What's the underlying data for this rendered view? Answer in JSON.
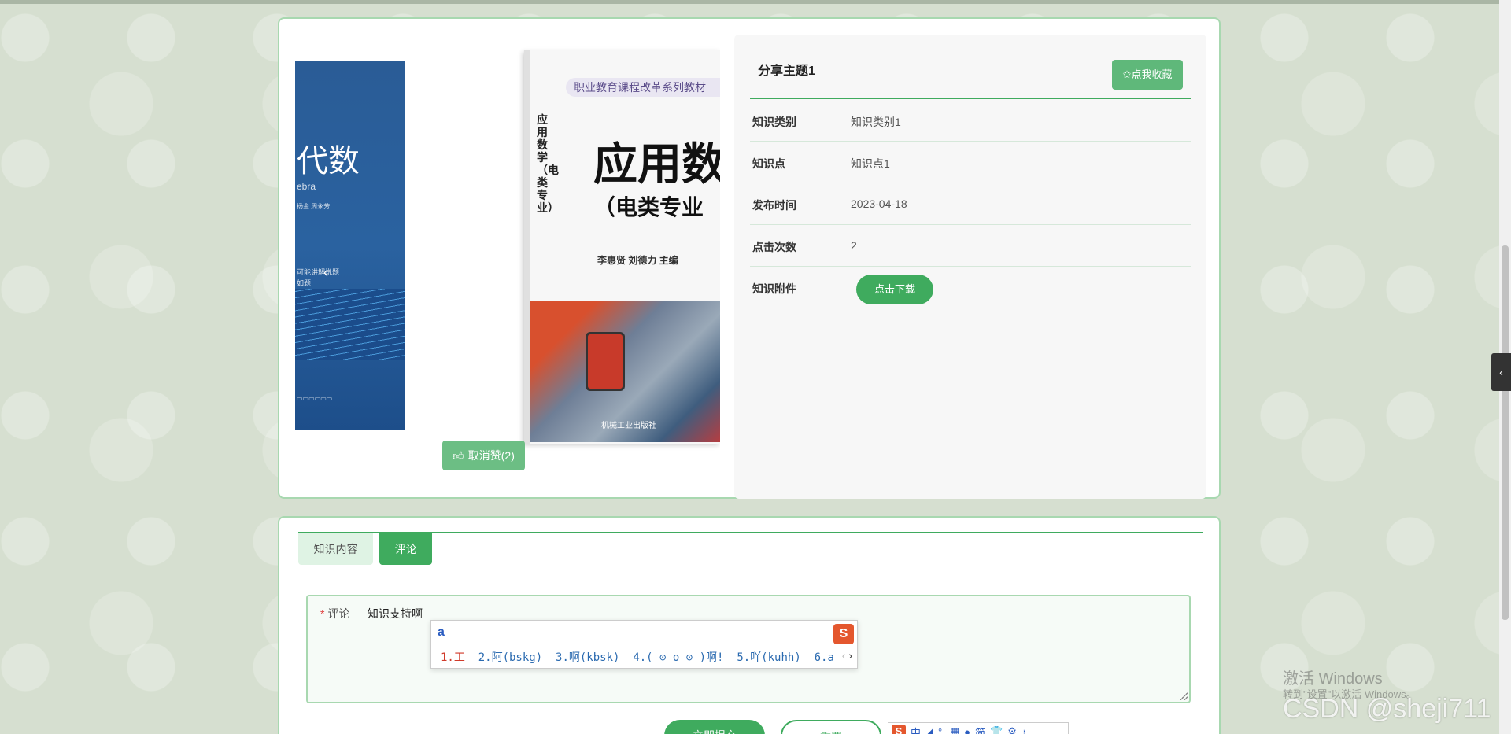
{
  "detail": {
    "carousel": {
      "left_book": {
        "title_fragment": "代数",
        "subtitle_fragment": "ebra",
        "authors_fragment": "杨金    周永芳",
        "blurb_fragment": "可能讲解说题\n如题",
        "prev_arrow": "‹"
      },
      "right_book": {
        "series": "职业教育课程改革系列教材",
        "vertical_title": "应用数学（电类专业）",
        "title": "应用数",
        "subtitle": "（电类专业",
        "authors": "李惠贤  刘德力  主编",
        "publisher": "机械工业出版社"
      }
    },
    "like_button": {
      "icon": "thumbs-up-icon",
      "label": "取消赞(2)"
    },
    "info": {
      "title": "分享主题1",
      "favorite_label": "✩点我收藏",
      "rows": [
        {
          "label": "知识类别",
          "value": "知识类别1"
        },
        {
          "label": "知识点",
          "value": "知识点1"
        },
        {
          "label": "发布时间",
          "value": "2023-04-18"
        },
        {
          "label": "点击次数",
          "value": "2"
        },
        {
          "label": "知识附件",
          "button": "点击下载"
        }
      ]
    }
  },
  "tabs": [
    {
      "label": "知识内容",
      "active": false
    },
    {
      "label": "评论",
      "active": true
    }
  ],
  "comment_form": {
    "required_mark": "*",
    "label": "评论",
    "value": "知识支持啊"
  },
  "ime": {
    "input": "a",
    "logo": "S",
    "candidates": [
      {
        "text": "1.工",
        "first": true
      },
      {
        "text": "2.阿(bskg)"
      },
      {
        "text": "3.啊(kbsk)"
      },
      {
        "text": "4.( ⊙ o ⊙ )啊!"
      },
      {
        "text": "5.吖(kuhh)"
      },
      {
        "text": "6.a"
      }
    ],
    "nav_prev": "‹",
    "nav_next": "›",
    "toolbar": [
      "中",
      "◢",
      "°,",
      "▦",
      "●",
      "简",
      "👕",
      "⚙",
      "♪"
    ]
  },
  "buttons": {
    "submit": "立即提交",
    "reset": "重置"
  },
  "watermark": {
    "line1": "激活 Windows",
    "line2": "转到\"设置\"以激活 Windows。",
    "csdn": "CSDN @sheji711"
  },
  "side_handle": "‹",
  "colors": {
    "primary": "#3fab5e",
    "light_primary": "#6cbe84",
    "border": "#a8d8b0",
    "background": "#d6dfd0"
  }
}
